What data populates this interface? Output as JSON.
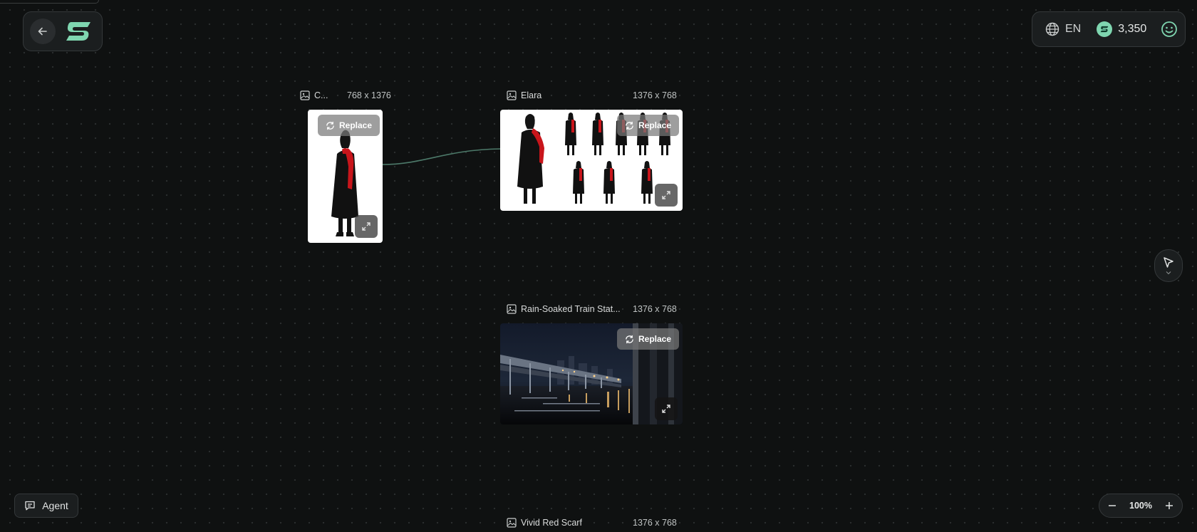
{
  "header": {
    "language": "EN",
    "credits": "3,350"
  },
  "nodes": [
    {
      "title": "C...",
      "dimensions": "768 x 1376",
      "replace_label": "Replace"
    },
    {
      "title": "Elara",
      "dimensions": "1376 x 768",
      "replace_label": "Replace"
    },
    {
      "title": "Rain-Soaked Train Stat...",
      "dimensions": "1376 x 768",
      "replace_label": "Replace"
    },
    {
      "title": "Vivid Red Scarf",
      "dimensions": "1376 x 768"
    }
  ],
  "agent": {
    "label": "Agent"
  },
  "zoom": {
    "level": "100%"
  },
  "colors": {
    "background": "#0f1111",
    "accent": "#7fd6b0",
    "scarf": "#c8151b",
    "panel": "#1b1e1f"
  },
  "icons": {
    "back": "arrow-left-icon",
    "language": "globe-icon",
    "credits": "coin-icon",
    "profile": "smiley-icon",
    "node": "image-icon",
    "replace": "refresh-icon",
    "expand": "expand-icon",
    "tool": "cursor-icon",
    "agent": "chat-icon"
  }
}
